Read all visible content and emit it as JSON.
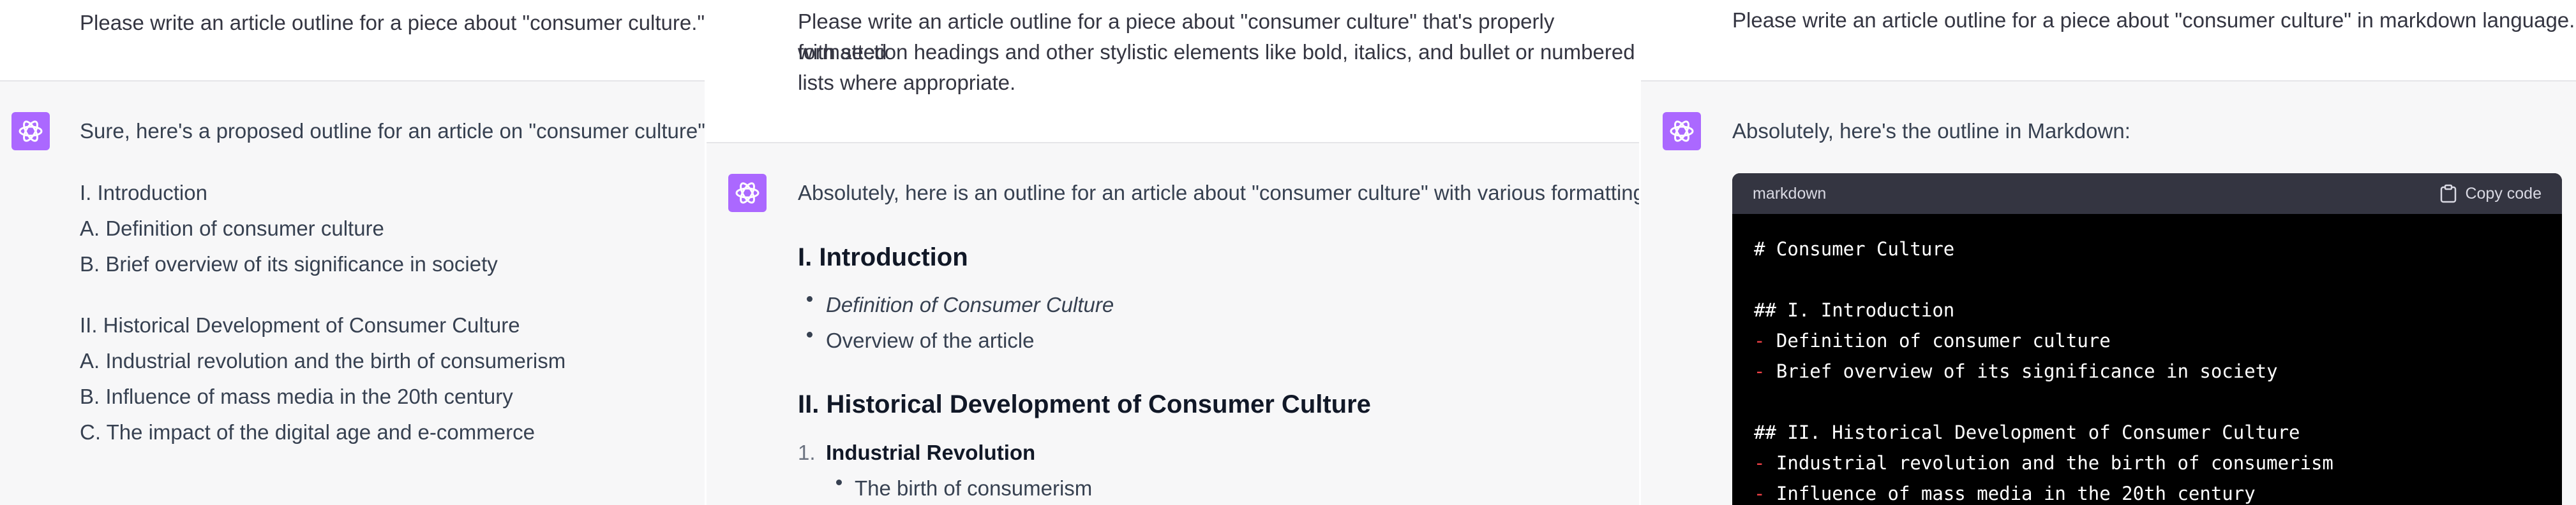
{
  "panel1": {
    "user_prompt": "Please write an article outline for a piece about \"consumer culture.\"",
    "intro": "Sure, here's a proposed outline for an article on \"consumer culture\":",
    "lines": [
      "I. Introduction",
      "A. Definition of consumer culture",
      "B. Brief overview of its significance in society",
      "II. Historical Development of Consumer Culture",
      "A. Industrial revolution and the birth of consumerism",
      "B. Influence of mass media in the 20th century",
      "C. The impact of the digital age and e-commerce"
    ]
  },
  "panel2": {
    "user_prompt_lines": [
      "Please write an article outline for a piece about \"consumer culture\" that's properly formatted",
      "with section headings and other stylistic elements like bold, italics, and bullet or numbered",
      "lists where appropriate."
    ],
    "intro": "Absolutely, here is an outline for an article about \"consumer culture\" with various formatting:",
    "heading1": "I. Introduction",
    "bullets": [
      "Definition of Consumer Culture",
      "Overview of the article"
    ],
    "heading2": "II. Historical Development of Consumer Culture",
    "numbered_label": "1.",
    "numbered_item": "Industrial Revolution",
    "sub_bullet": "The birth of consumerism"
  },
  "panel3": {
    "user_prompt": "Please write an article outline for a piece about \"consumer culture\" in markdown language.",
    "intro": "Absolutely, here's the outline in Markdown:",
    "code_lang": "markdown",
    "copy_label": "Copy code",
    "code_lines": [
      {
        "prefix": "",
        "text": "# Consumer Culture"
      },
      {
        "prefix": "",
        "text": ""
      },
      {
        "prefix": "",
        "text": "## I. Introduction"
      },
      {
        "prefix": "- ",
        "text": "Definition of consumer culture"
      },
      {
        "prefix": "- ",
        "text": "Brief overview of its significance in society"
      },
      {
        "prefix": "",
        "text": ""
      },
      {
        "prefix": "",
        "text": "## II. Historical Development of Consumer Culture"
      },
      {
        "prefix": "- ",
        "text": "Industrial revolution and the birth of consumerism"
      },
      {
        "prefix": "- ",
        "text": "Influence of mass media in the 20th century"
      }
    ]
  },
  "icons": {
    "assistant_avatar": "openai-logo-icon",
    "copy": "clipboard-icon"
  },
  "colors": {
    "avatar_bg": "#ab68ff",
    "markdown_dash": "#ef4146",
    "code_bg": "#000000",
    "code_header_bg": "#343541"
  }
}
